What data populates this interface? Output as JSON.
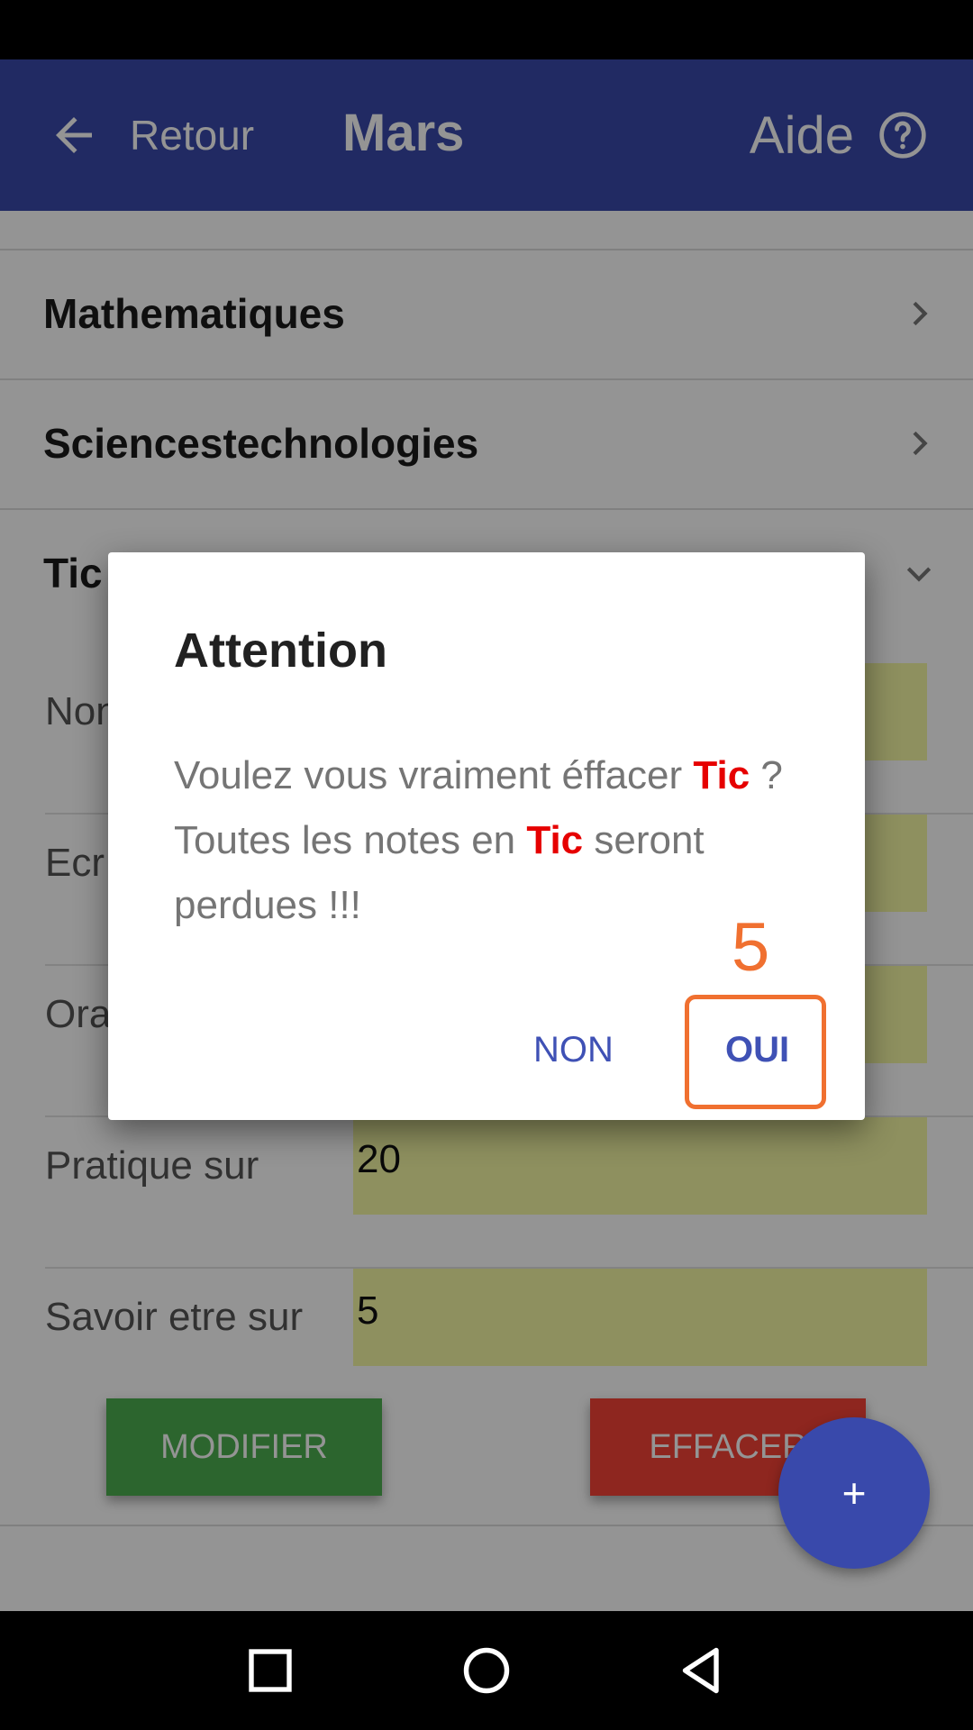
{
  "app_bar": {
    "back_label": "Retour",
    "title": "Mars",
    "help_label": "Aide",
    "color": "#3949ab"
  },
  "subjects": [
    {
      "label": "Mathematiques",
      "icon": "chevron-right-icon"
    },
    {
      "label": "Sciencestechnologies",
      "icon": "chevron-right-icon"
    },
    {
      "label": "Tic",
      "icon": "chevron-down-icon"
    }
  ],
  "fields": [
    {
      "label": "Non",
      "value": ""
    },
    {
      "label": "Ecr",
      "value": ""
    },
    {
      "label": "Ora",
      "value": ""
    },
    {
      "label": "Pratique sur",
      "value": "20"
    },
    {
      "label": "Savoir etre sur",
      "value": "5"
    }
  ],
  "actions": {
    "modifier": "MODIFIER",
    "effacer": "EFFACER",
    "fab": "+"
  },
  "dialog": {
    "title": "Attention",
    "message_part1": "Voulez vous vraiment éffacer ",
    "highlight1": "Tic",
    "message_part2": " ? Toutes les notes en ",
    "highlight2": "Tic",
    "message_part3": " seront perdues !!!",
    "no_label": "NON",
    "yes_label": "OUI",
    "highlight_color": "#e60000"
  },
  "annotation": {
    "step": "5",
    "color": "#f07030"
  },
  "nav_bar": {
    "icons": [
      "square-icon",
      "circle-icon",
      "back-triangle-icon"
    ]
  }
}
